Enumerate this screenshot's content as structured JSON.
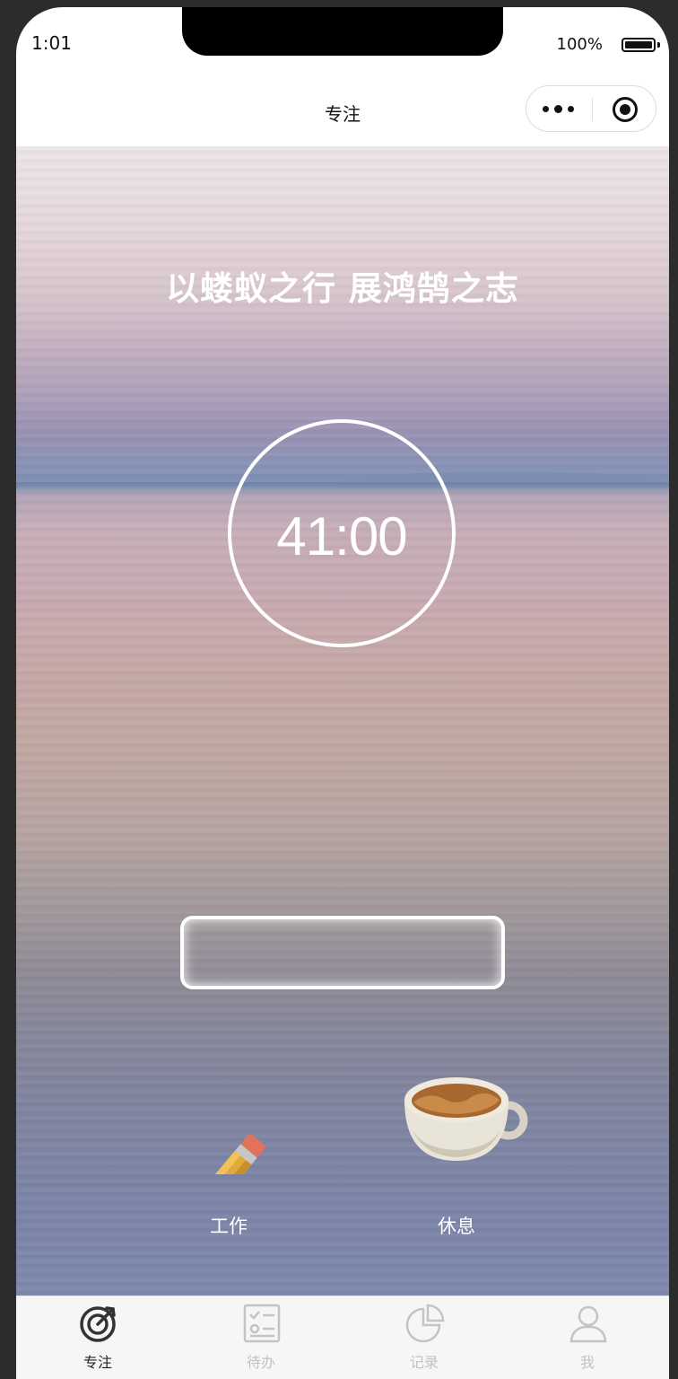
{
  "status_bar": {
    "time": "1:01",
    "battery": "100%"
  },
  "nav": {
    "title": "专注",
    "more_icon": "more-dots-icon",
    "close_icon": "target-close-icon"
  },
  "main": {
    "motto": "以蝼蚁之行 展鸿鹄之志",
    "timer": "41:00",
    "task_input": {
      "value": "",
      "placeholder": ""
    },
    "modes": [
      {
        "label": "工作",
        "icon": "pencil-icon"
      },
      {
        "label": "休息",
        "icon": "coffee-cup-icon"
      }
    ]
  },
  "tabbar": {
    "items": [
      {
        "label": "专注",
        "icon": "focus-target-icon",
        "active": true
      },
      {
        "label": "待办",
        "icon": "todo-list-icon",
        "active": false
      },
      {
        "label": "记录",
        "icon": "pie-chart-icon",
        "active": false
      },
      {
        "label": "我",
        "icon": "user-icon",
        "active": false
      }
    ],
    "active_color": "#222222",
    "inactive_color": "#c2c2c2"
  }
}
